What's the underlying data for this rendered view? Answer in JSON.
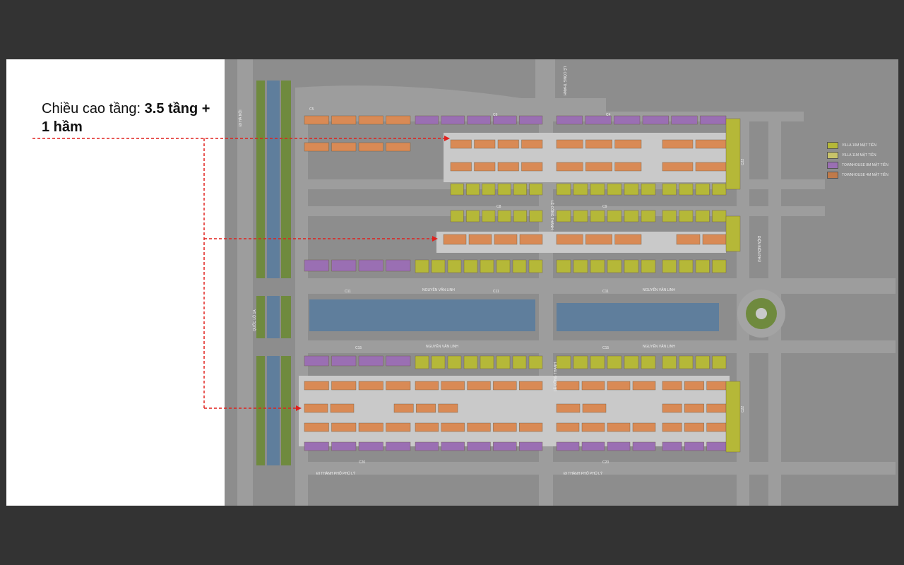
{
  "caption": {
    "normal": "Chiều cao tầng: ",
    "bold": "3.5 tầng + 1 hầm"
  },
  "legend": [
    {
      "label": "VILLA 10M MẶT TIỀN",
      "color": "#b5b838"
    },
    {
      "label": "VILLA 11M MẶT TIỀN",
      "color": "#c8c36a"
    },
    {
      "label": "TOWNHOUSE 8M MẶT TIỀN",
      "color": "#9a6fb3"
    },
    {
      "label": "TOWNHOUSE 4M MẶT TIỀN",
      "color": "#c07a4a"
    }
  ],
  "street_labels": {
    "di_ha_noi": "ĐI HÀ NỘI",
    "quoc_lo": "QUỐC LỘ 1A",
    "nguyen_van_linh_1": "NGUYỄN VĂN LINH",
    "nguyen_van_linh_2": "NGUYỄN VĂN LINH",
    "nguyen_van_linh_3": "NGUYỄN VĂN LINH",
    "nguyen_van_linh_4": "NGUYỄN VĂN LINH",
    "le_cong_thanh_top": "LÊ CÔNG THANH",
    "le_cong_thanh_mid": "LÊ CÔNG THANH",
    "le_cong_thanh_bottom": "LÊ CÔNG THANH",
    "bien_bien_phu": "ĐIỆN BIÊN PHỦ",
    "di_thanh_pho_phu_ly_1": "ĐI THÀNH PHỐ PHỦ LÝ",
    "di_thanh_pho_phu_ly_2": "ĐI THÀNH PHỐ PHỦ LÝ"
  },
  "block_labels": {
    "c5": "C5",
    "c6": "C6",
    "c4": "C4",
    "c8": "C8",
    "c9": "C9",
    "c11a": "C11",
    "c11b": "C11",
    "c11c": "C11",
    "c15a": "C15",
    "c15b": "C15",
    "c20a": "C20",
    "c20b": "C20",
    "c22a": "C22",
    "c22b": "C22"
  },
  "colors": {
    "background": "#333333",
    "villa10": "#b5b838",
    "townhouse4": "#d98a55",
    "townhouse8": "#9a6fb3",
    "water": "#5f7e9c",
    "leader": "#e0201d"
  }
}
